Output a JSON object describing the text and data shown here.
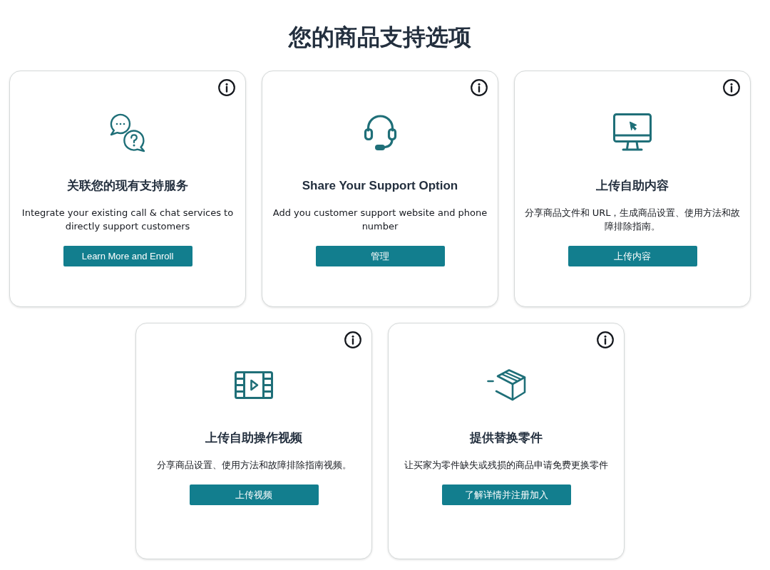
{
  "title": "您的商品支持选项",
  "cards": [
    {
      "kind": "chat",
      "title": "关联您的现有支持服务",
      "description": "Integrate your existing call & chat services to directly support customers",
      "button": "Learn More and Enroll"
    },
    {
      "kind": "headset",
      "title": "Share Your Support Option",
      "description": "Add you customer support website and phone number",
      "button": "管理"
    },
    {
      "kind": "monitor",
      "title": "上传自助内容",
      "description": "分享商品文件和 URL，生成商品设置、使用方法和故障排除指南。",
      "button": "上传内容"
    },
    {
      "kind": "video",
      "title": "上传自助操作视频",
      "description": "分享商品设置、使用方法和故障排除指南视频。",
      "button": "上传视频"
    },
    {
      "kind": "box",
      "title": "提供替换零件",
      "description": "让买家为零件缺失或残损的商品申请免费更换零件",
      "button": "了解详情并注册加入"
    }
  ]
}
